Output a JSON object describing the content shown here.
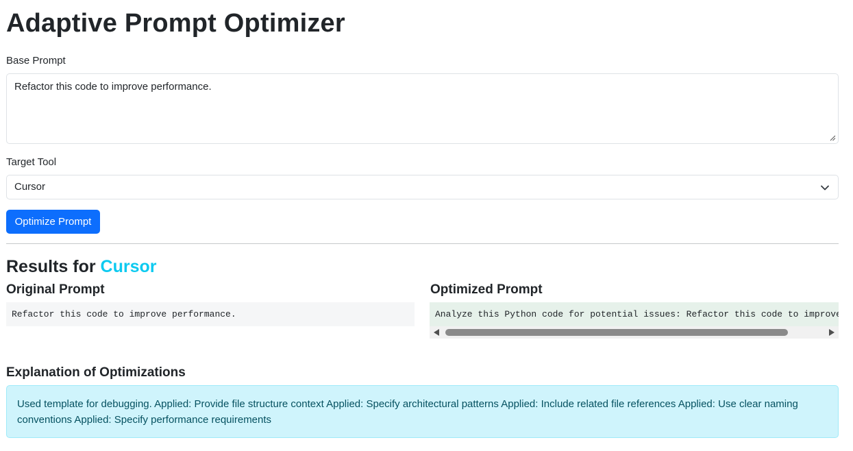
{
  "page": {
    "title": "Adaptive Prompt Optimizer"
  },
  "form": {
    "base_prompt_label": "Base Prompt",
    "base_prompt_value": "Refactor this code to improve performance.",
    "target_tool_label": "Target Tool",
    "target_tool_value": "Cursor",
    "optimize_button": "Optimize Prompt"
  },
  "results": {
    "heading_prefix": "Results for ",
    "tool": "Cursor",
    "original_heading": "Original Prompt",
    "original_text": "Refactor this code to improve performance.",
    "optimized_heading": "Optimized Prompt",
    "optimized_text": "Analyze this Python code for potential issues: Refactor this code to improve performance.",
    "explanation_heading": "Explanation of Optimizations",
    "explanation_text": "Used template for debugging. Applied: Provide file structure context Applied: Specify architectural patterns Applied: Include related file references Applied: Use clear naming conventions Applied: Specify performance requirements"
  },
  "colors": {
    "primary": "#0d6efd",
    "accent_tool": "#0dcaf0",
    "alert_bg": "#cff4fc",
    "alert_text": "#055160"
  },
  "icons": {
    "select_chevron": "chevron-down-icon",
    "resize_grip": "resize-grip-icon"
  }
}
